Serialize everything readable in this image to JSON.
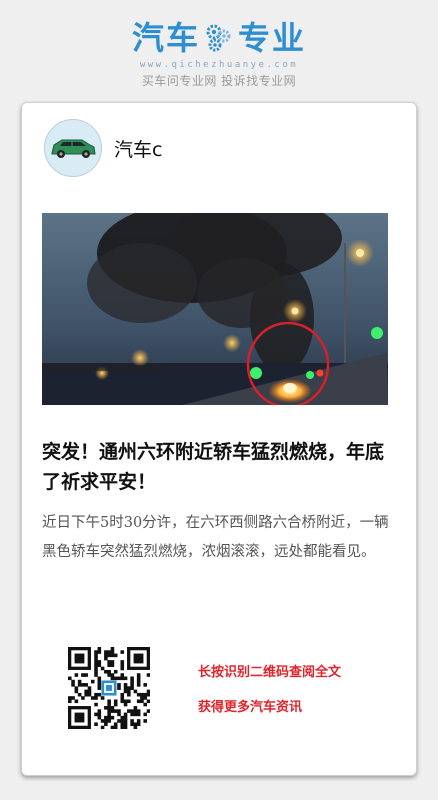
{
  "brand": {
    "title_left": "汽车",
    "title_right": "专业",
    "logo_icon": "gear-cluster-icon",
    "url": "www.qichezhuanye.com",
    "slogan": "买车问专业网 投诉找专业网",
    "accent_color": "#2e8fd0"
  },
  "author": {
    "name": "汽车c",
    "avatar_icon": "green-car-icon"
  },
  "article": {
    "image_alt": "night street with burning car and black smoke",
    "headline": "突发！通州六环附近轿车猛烈燃烧，年底了祈求平安！",
    "body": "近日下午5时30分许，在六环西侧路六合桥附近，一辆黑色轿车突然猛烈燃烧，浓烟滚滚，远处都能看见。"
  },
  "footer": {
    "qr_icon": "qr-code-icon",
    "cta_line1": "长按识别二维码查阅全文",
    "cta_line2": "获得更多汽车资讯",
    "cta_color": "#e0242b"
  }
}
